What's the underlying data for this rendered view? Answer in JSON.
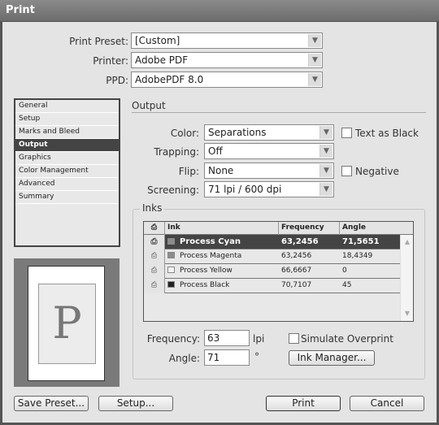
{
  "window": {
    "title": "Print"
  },
  "top_fields": [
    {
      "label": "Print Preset:",
      "value": "[Custom]"
    },
    {
      "label": "Printer:",
      "value": "Adobe PDF"
    },
    {
      "label": "PPD:",
      "value": "AdobePDF 8.0"
    }
  ],
  "sidebar": {
    "items": [
      {
        "label": "General"
      },
      {
        "label": "Setup"
      },
      {
        "label": "Marks and Bleed"
      },
      {
        "label": "Output",
        "active": true
      },
      {
        "label": "Graphics"
      },
      {
        "label": "Color Management"
      },
      {
        "label": "Advanced"
      },
      {
        "label": "Summary"
      }
    ]
  },
  "preview": {
    "glyph": "P"
  },
  "output": {
    "title": "Output",
    "color": {
      "label": "Color:",
      "value": "Separations"
    },
    "trapping": {
      "label": "Trapping:",
      "value": "Off"
    },
    "flip": {
      "label": "Flip:",
      "value": "None"
    },
    "screening": {
      "label": "Screening:",
      "value": "71 lpi / 600 dpi"
    },
    "text_as_black": {
      "label": "Text as Black",
      "checked": false
    },
    "negative": {
      "label": "Negative",
      "checked": false
    }
  },
  "inks": {
    "title": "Inks",
    "columns": {
      "print": "",
      "ink": "Ink",
      "frequency": "Frequency",
      "angle": "Angle"
    },
    "rows": [
      {
        "ink": "Process Cyan",
        "frequency": "63,2456",
        "angle": "71,5651",
        "swatch": "#8a8a8a",
        "selected": true
      },
      {
        "ink": "Process Magenta",
        "frequency": "63,2456",
        "angle": "18,4349",
        "swatch": "#8c8c8c"
      },
      {
        "ink": "Process Yellow",
        "frequency": "66,6667",
        "angle": "0",
        "swatch": "#f4f4f4"
      },
      {
        "ink": "Process Black",
        "frequency": "70,7107",
        "angle": "45",
        "swatch": "#222222"
      }
    ],
    "frequency": {
      "label": "Frequency:",
      "value": "63",
      "unit": "lpi"
    },
    "angle": {
      "label": "Angle:",
      "value": "71",
      "unit": "°"
    },
    "simulate_overprint": {
      "label": "Simulate Overprint",
      "checked": false
    },
    "ink_manager_label": "Ink Manager..."
  },
  "buttons": {
    "save_preset": "Save Preset...",
    "setup": "Setup...",
    "print": "Print",
    "cancel": "Cancel"
  },
  "icons": {
    "dropdown": "▼",
    "printer": "🖶",
    "scroll_up": "▲",
    "scroll_down": "▼"
  }
}
